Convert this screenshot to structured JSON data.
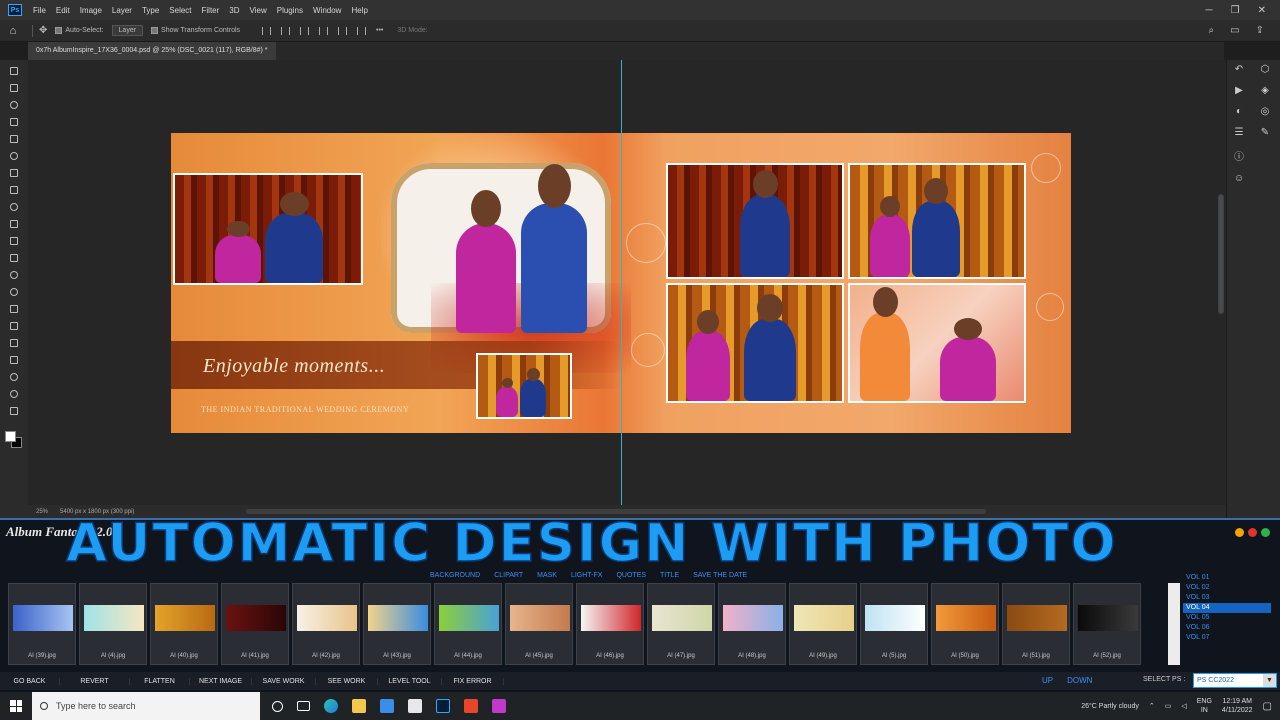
{
  "menubar": {
    "items": [
      "File",
      "Edit",
      "Image",
      "Layer",
      "Type",
      "Select",
      "Filter",
      "3D",
      "View",
      "Plugins",
      "Window",
      "Help"
    ]
  },
  "options": {
    "auto_select": "Auto-Select:",
    "layer_dropdown": "Layer",
    "show_transform": "Show Transform Controls",
    "mode_label": "3D Mode:"
  },
  "document": {
    "tab_label": "0x7h AlbumInspire_17X36_0004.psd @ 25% (DSC_0021 (117), RGB/8#) *"
  },
  "status": {
    "zoom": "25%",
    "doc_size": "5400 px x 1800 px (300 ppi)"
  },
  "album": {
    "title": "Enjoyable moments...",
    "subtitle": "THE INDIAN TRADITIONAL WEDDING CEREMONY"
  },
  "plugin": {
    "title": "Album Fantasia 2.0",
    "overlay_text": "AUTOMATIC DESIGN WITH PHOTO",
    "category_tabs": [
      "BACKGROUND",
      "CLIPART",
      "MASK",
      "LIGHT-FX",
      "QUOTES",
      "TITLE",
      "SAVE THE DATE"
    ],
    "thumbnails": [
      {
        "caption": "AI (39).jpg",
        "color1": "#3b63c9",
        "color2": "#a8c4f2"
      },
      {
        "caption": "AI (4).jpg",
        "color1": "#9fe3e6",
        "color2": "#f5e7c2"
      },
      {
        "caption": "AI (40).jpg",
        "color1": "#e4a32b",
        "color2": "#b86a12"
      },
      {
        "caption": "AI (41).jpg",
        "color1": "#6b1212",
        "color2": "#2a0606"
      },
      {
        "caption": "AI (42).jpg",
        "color1": "#f7f1e6",
        "color2": "#e8c48a"
      },
      {
        "caption": "AI (43).jpg",
        "color1": "#f1d48a",
        "color2": "#3a8ce0"
      },
      {
        "caption": "AI (44).jpg",
        "color1": "#8ccf3a",
        "color2": "#4aa0d8"
      },
      {
        "caption": "AI (45).jpg",
        "color1": "#e7b48c",
        "color2": "#c47a4e"
      },
      {
        "caption": "AI (46).jpg",
        "color1": "#f5f5f5",
        "color2": "#d0262b"
      },
      {
        "caption": "AI (47).jpg",
        "color1": "#e9e4d2",
        "color2": "#cfd7a8"
      },
      {
        "caption": "AI (48).jpg",
        "color1": "#f0b2c8",
        "color2": "#8ab0e8"
      },
      {
        "caption": "AI (49).jpg",
        "color1": "#efe6b6",
        "color2": "#e7d08a"
      },
      {
        "caption": "AI (5).jpg",
        "color1": "#bfe3f2",
        "color2": "#ffffff"
      },
      {
        "caption": "AI (50).jpg",
        "color1": "#f29a3a",
        "color2": "#c65a12"
      },
      {
        "caption": "AI (51).jpg",
        "color1": "#8a4a12",
        "color2": "#b66a22"
      },
      {
        "caption": "AI (52).jpg",
        "color1": "#0a0a0a",
        "color2": "#3a3a3a"
      }
    ],
    "volumes": [
      "VOL 01",
      "VOL 02",
      "VOL 03",
      "VOL 04",
      "VOL 05",
      "VOL 06",
      "VOL 07"
    ],
    "selected_volume": "VOL 04",
    "buttons": [
      "GO BACK",
      "REVERT",
      "FLATTEN",
      "NEXT IMAGE",
      "SAVE WORK",
      "SEE WORK",
      "LEVEL TOOL",
      "FIX ERROR"
    ],
    "up_label": "UP",
    "down_label": "DOWN",
    "select_ps_label": "SELECT PS :",
    "ps_version": "PS CC2022"
  },
  "taskbar": {
    "search_placeholder": "Type here to search",
    "weather": "26°C  Partly cloudy",
    "lang_top": "ENG",
    "lang_bottom": "IN",
    "time": "12:19 AM",
    "date": "4/11/2022"
  },
  "colors": {
    "accent_blue": "#1c9cf2",
    "guide_cyan": "#2ab7c8",
    "ps_panel": "#2b2b2b"
  }
}
